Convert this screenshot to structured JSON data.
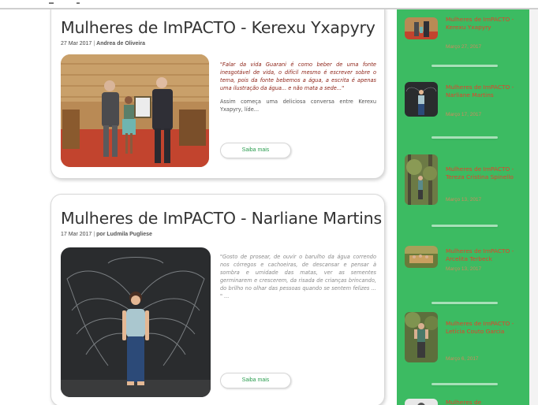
{
  "posts": [
    {
      "title": "Mulheres de ImPACTO - Kerexu Yxapyry",
      "date": "27 Mar 2017",
      "author": "Andrea de Oliveira",
      "quote": "\"Falar da vida Guarani é como beber de uma fonte inesgotável de vida, o difícil mesmo é escrever sobre o tema, pois da fonte bebemos a água, a escrita é apenas uma ilustração da água... e não mata a sede...\"",
      "excerpt": "Assim começa uma deliciosa conversa entre Kerexu Yxapyry, líde...",
      "button": "Saiba mais"
    },
    {
      "title": "Mulheres de ImPACTO - Narliane Martins",
      "date": "17 Mar 2017",
      "author": "por Ludmila Pugliese",
      "quote": "\"Gosto de prosear, de ouvir o barulho da água correndo nos córregos e cachoeiras, de descansar e pensar à sombra e umidade das matas, ver as sementes germinarem e crescerem, da risada de crianças brincando, do brilho no olhar das pessoas quando se sentem felizes ... \" ...",
      "button": "Saiba mais"
    }
  ],
  "sidebar": {
    "items": [
      {
        "title": "Mulheres de ImPACTO - Kerexu Yxapyry",
        "date": "Março 27, 2017"
      },
      {
        "title": "Mulheres de ImPACTO - Narliane Martins",
        "date": "Março 17, 2017"
      },
      {
        "title": "Mulheres de ImPACTO - Tereza Cristina Spinello",
        "date": "Março 13, 2017"
      },
      {
        "title": "Mulheres de ImPACTO - Arcelita Terbeck",
        "date": "Março 13, 2017"
      },
      {
        "title": "Mulheres de ImPACTO - Letícia Couto Garcia",
        "date": "Março 6, 2017"
      },
      {
        "title": "Mulheres de"
      }
    ]
  },
  "colors": {
    "sidebar_bg": "#3cbb62",
    "sidebar_link": "#e3412a",
    "button_text": "#2e9e52",
    "quote_red": "#8b1e12"
  },
  "icons": [
    "post-photo",
    "sidebar-thumbnail"
  ]
}
